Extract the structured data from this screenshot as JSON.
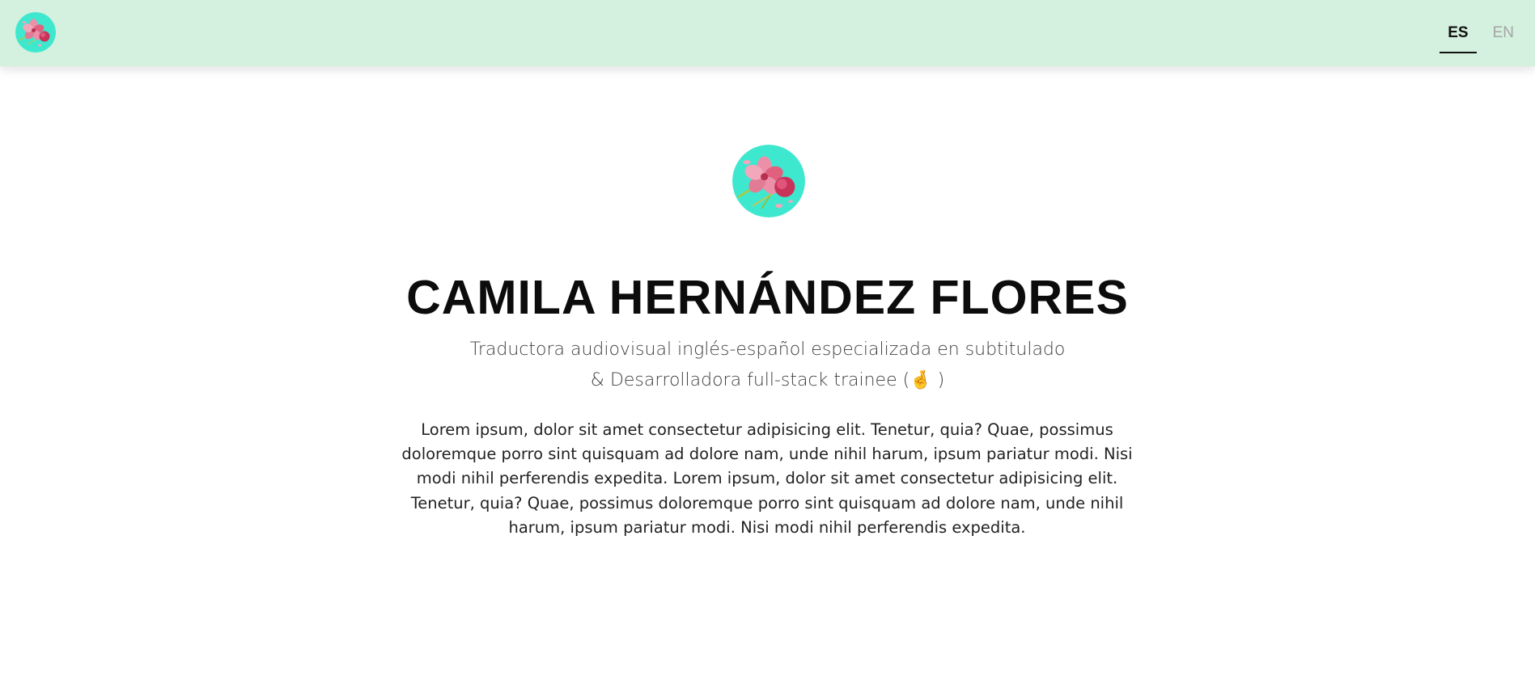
{
  "header": {
    "logo_icon": "flower-avatar-icon",
    "background": "#d4f0de",
    "languages": [
      {
        "label": "ES",
        "active": true
      },
      {
        "label": "EN",
        "active": false
      }
    ]
  },
  "hero": {
    "avatar_icon": "flower-avatar-icon",
    "name": "CAMILA HERNÁNDEZ FLORES",
    "subtitle_line1": "Traductora audiovisual inglés-español especializada en subtitulado",
    "subtitle_line2_prefix": "& Desarrolladora full-stack trainee (",
    "subtitle_line2_emoji": "🤞",
    "subtitle_line2_suffix": ")",
    "bio": "Lorem ipsum, dolor sit amet consectetur adipisicing elit. Tenetur, quia? Quae, possimus doloremque porro sint quisquam ad dolore nam, unde nihil harum, ipsum pariatur modi. Nisi modi nihil perferendis expedita. Lorem ipsum, dolor sit amet consectetur adipisicing elit. Tenetur, quia? Quae, possimus doloremque porro sint quisquam ad dolore nam, unde nihil harum, ipsum pariatur modi. Nisi modi nihil perferendis expedita."
  },
  "colors": {
    "accent_teal": "#3ee8cf",
    "flower_pink": "#e0607e",
    "nav_bg": "#d4f0de"
  }
}
